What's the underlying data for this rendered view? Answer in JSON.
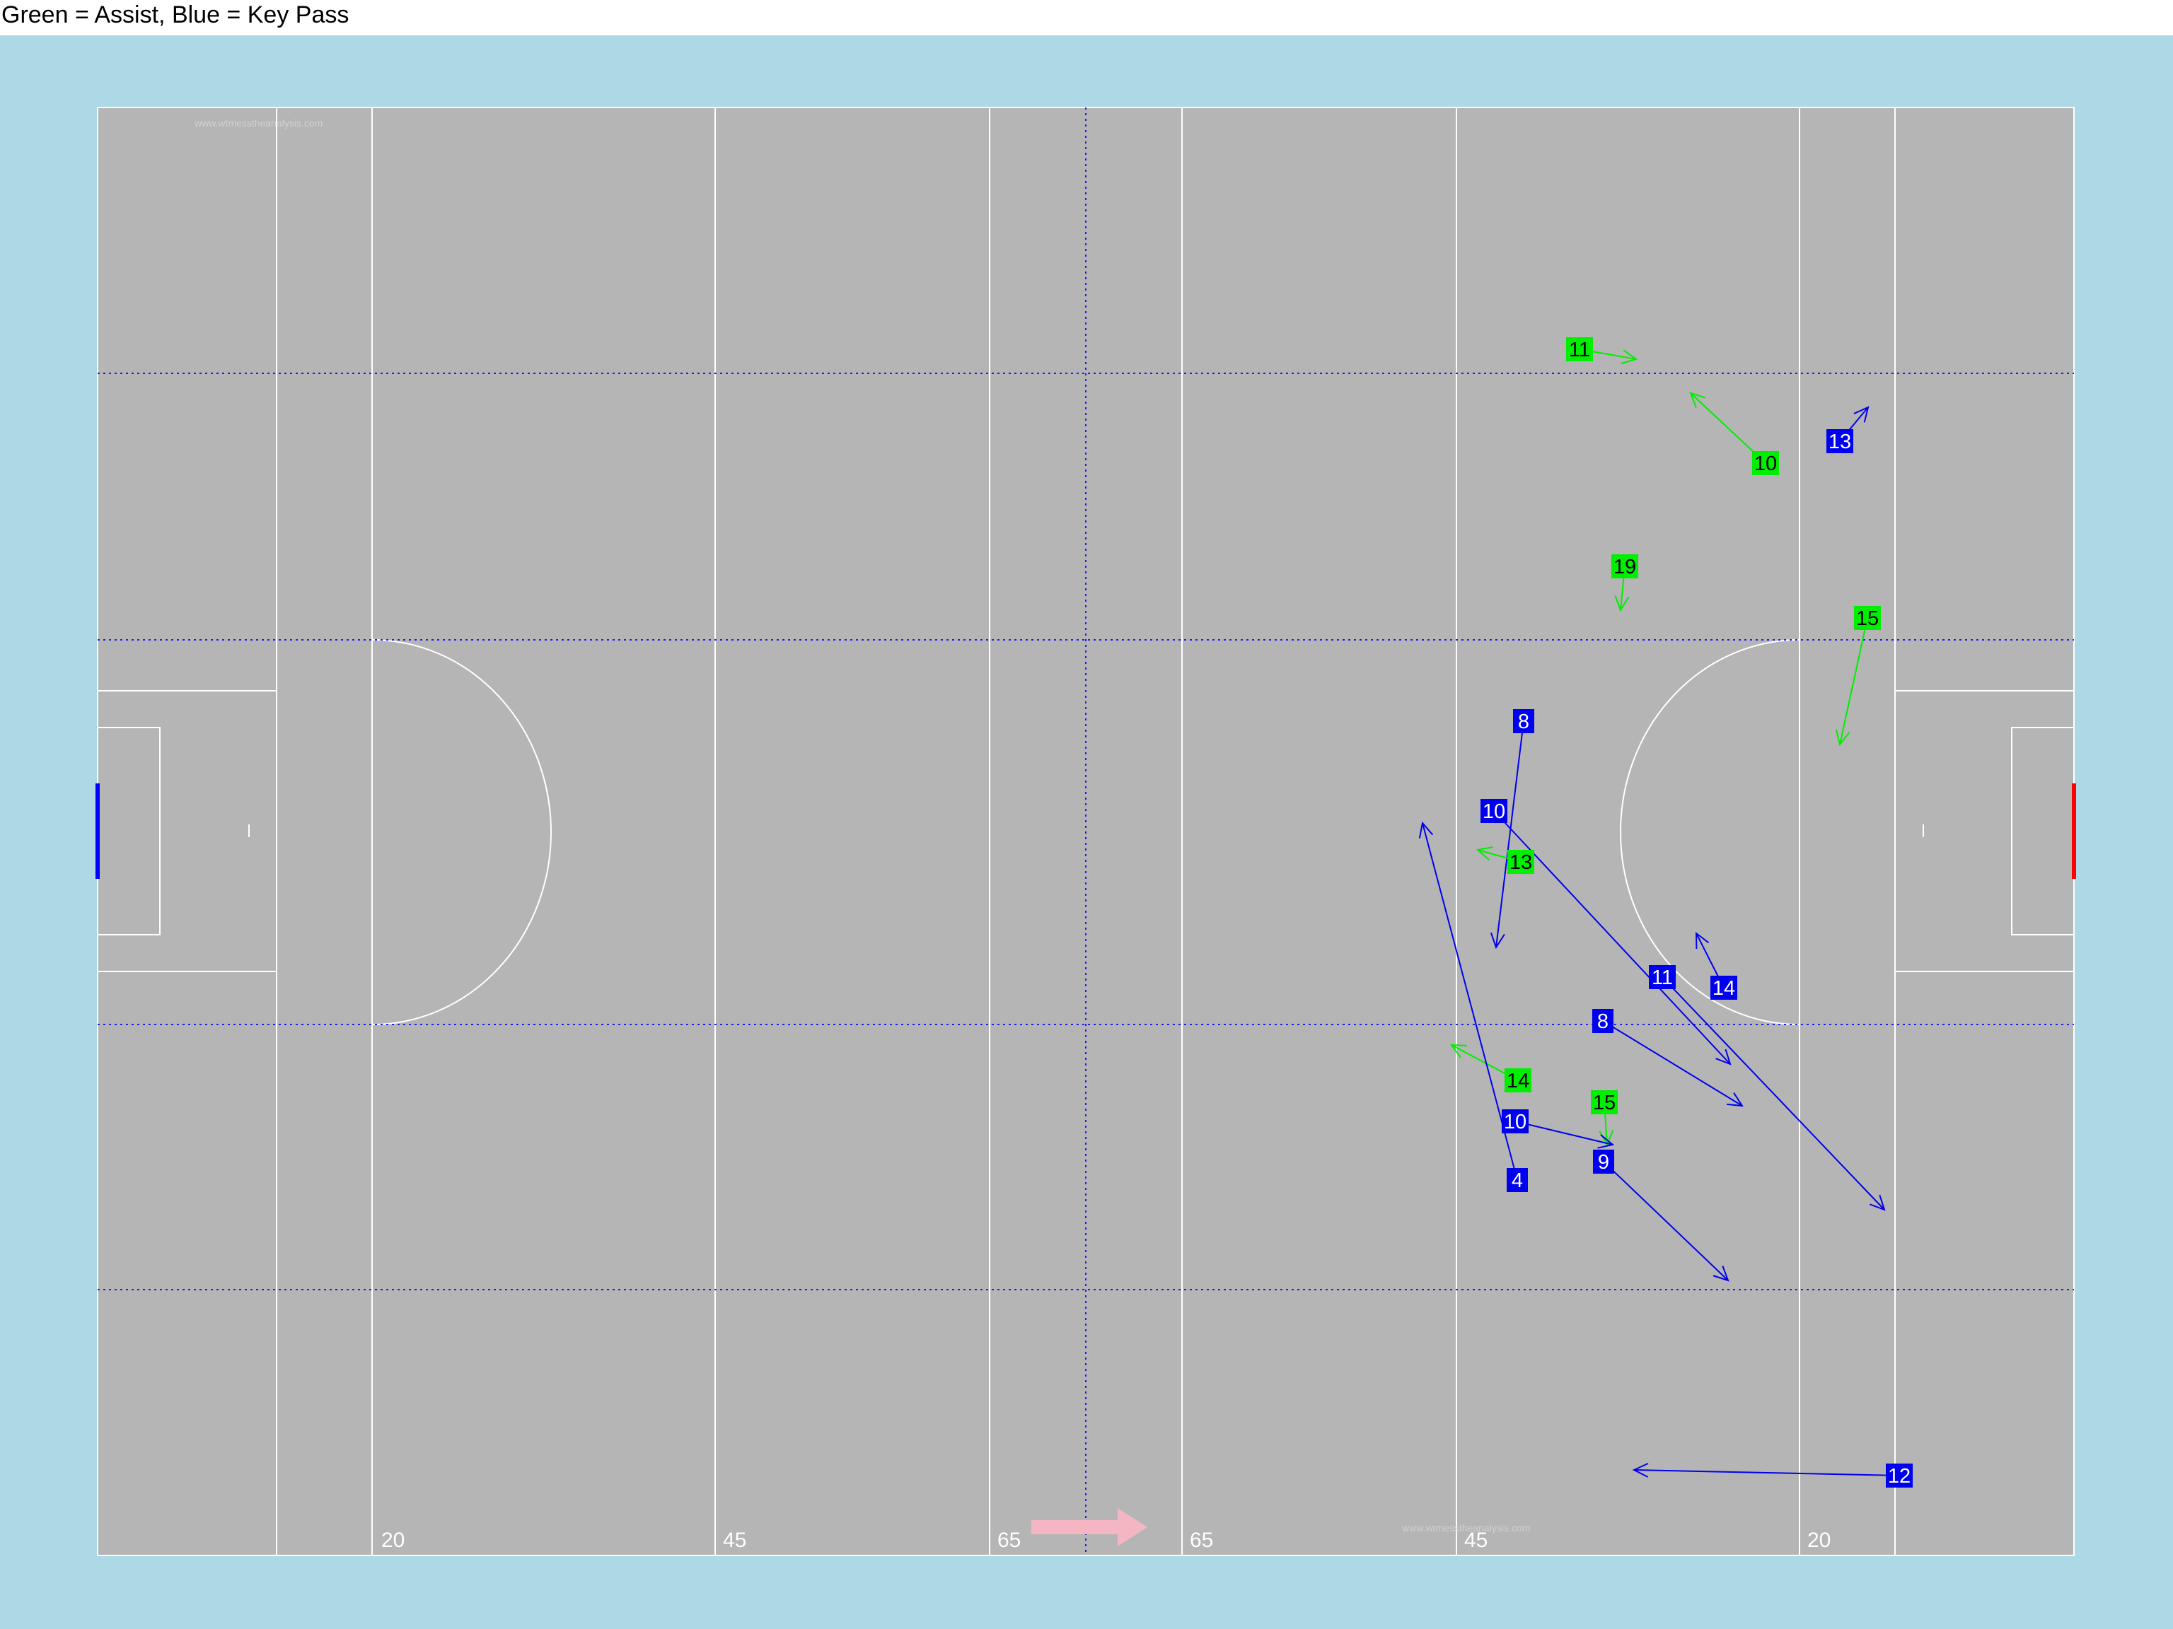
{
  "legend": {
    "text": "Green = Assist, Blue = Key Pass"
  },
  "pitch": {
    "watermark": "www.wtmesstheanalysis.com",
    "labels": [
      {
        "id": "left-20",
        "text": "20"
      },
      {
        "id": "left-45",
        "text": "45"
      },
      {
        "id": "left-65",
        "text": "65"
      },
      {
        "id": "right-65",
        "text": "65"
      },
      {
        "id": "right-45",
        "text": "45"
      },
      {
        "id": "right-20",
        "text": "20"
      }
    ],
    "colors": {
      "background": "#add8e6",
      "pitch": "#b5b5b5",
      "lines": "#ffffff",
      "dotted": "#1e1ee6",
      "direction_arrow": "#f4b6c2",
      "left_goal": "#0000ff",
      "right_goal": "#ff0000"
    }
  },
  "series_colors": {
    "assist": "#00ee00",
    "key_pass": "#0000ee"
  },
  "passes": [
    {
      "type": "assist",
      "label": "11",
      "from": [
        2233,
        494
      ],
      "to": [
        2313,
        508
      ]
    },
    {
      "type": "assist",
      "label": "10",
      "from": [
        2496,
        655
      ],
      "to": [
        2390,
        556
      ]
    },
    {
      "type": "key_pass",
      "label": "13",
      "from": [
        2601,
        624
      ],
      "to": [
        2641,
        576
      ]
    },
    {
      "type": "assist",
      "label": "19",
      "from": [
        2297,
        801
      ],
      "to": [
        2291,
        863
      ]
    },
    {
      "type": "assist",
      "label": "15",
      "from": [
        2640,
        874
      ],
      "to": [
        2601,
        1053
      ]
    },
    {
      "type": "key_pass",
      "label": "8",
      "from": [
        2154,
        1020
      ],
      "to": [
        2115,
        1340
      ]
    },
    {
      "type": "key_pass",
      "label": "10",
      "from": [
        2112,
        1147
      ],
      "to": [
        2446,
        1505
      ]
    },
    {
      "type": "assist",
      "label": "13",
      "from": [
        2150,
        1219
      ],
      "to": [
        2089,
        1202
      ]
    },
    {
      "type": "key_pass",
      "label": "11",
      "from": [
        2350,
        1382
      ],
      "to": [
        2664,
        1711
      ]
    },
    {
      "type": "key_pass",
      "label": "14",
      "from": [
        2437,
        1397
      ],
      "to": [
        2398,
        1320
      ]
    },
    {
      "type": "key_pass",
      "label": "8",
      "from": [
        2266,
        1444
      ],
      "to": [
        2463,
        1564
      ]
    },
    {
      "type": "assist",
      "label": "14",
      "from": [
        2146,
        1528
      ],
      "to": [
        2052,
        1478
      ]
    },
    {
      "type": "assist",
      "label": "15",
      "from": [
        2268,
        1559
      ],
      "to": [
        2272,
        1619
      ]
    },
    {
      "type": "key_pass",
      "label": "10",
      "from": [
        2142,
        1586
      ],
      "to": [
        2280,
        1619
      ]
    },
    {
      "type": "key_pass",
      "label": "9",
      "from": [
        2267,
        1643
      ],
      "to": [
        2443,
        1811
      ]
    },
    {
      "type": "key_pass",
      "label": "4",
      "from": [
        2145,
        1669
      ],
      "to": [
        2011,
        1164
      ]
    },
    {
      "type": "key_pass",
      "label": "12",
      "from": [
        2685,
        2087
      ],
      "to": [
        2310,
        2079
      ]
    }
  ]
}
